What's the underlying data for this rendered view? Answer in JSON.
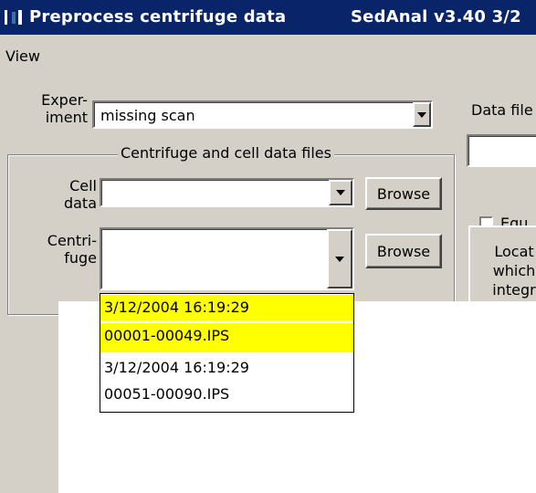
{
  "window": {
    "title": "Preprocess centrifuge data",
    "app_version": "SedAnal v3.40  3/2"
  },
  "menu": {
    "view": "View"
  },
  "experiment": {
    "label_line1": "Exper-",
    "label_line2": "iment",
    "value": "missing scan"
  },
  "data_file": {
    "label": "Data file"
  },
  "group": {
    "title": "Centrifuge and cell data files"
  },
  "cell_data": {
    "label_line1": "Cell",
    "label_line2": "data",
    "value": "",
    "browse_label": "Browse"
  },
  "centrifuge": {
    "label_line1": "Centri-",
    "label_line2": "fuge",
    "value": "",
    "browse_label": "Browse"
  },
  "dropdown_items": [
    {
      "text": "3/12/2004  16:19:29",
      "highlighted": true
    },
    {
      "text": "00001-00049.IPS",
      "highlighted": true
    },
    {
      "text": "3/12/2004  16:19:29",
      "highlighted": false
    },
    {
      "text": "00051-00090.IPS",
      "highlighted": false
    }
  ],
  "right_panel": {
    "checkbox_label": "Equ",
    "locate_button": {
      "line1": "Locat",
      "line2": "which",
      "line3": "integr"
    }
  }
}
